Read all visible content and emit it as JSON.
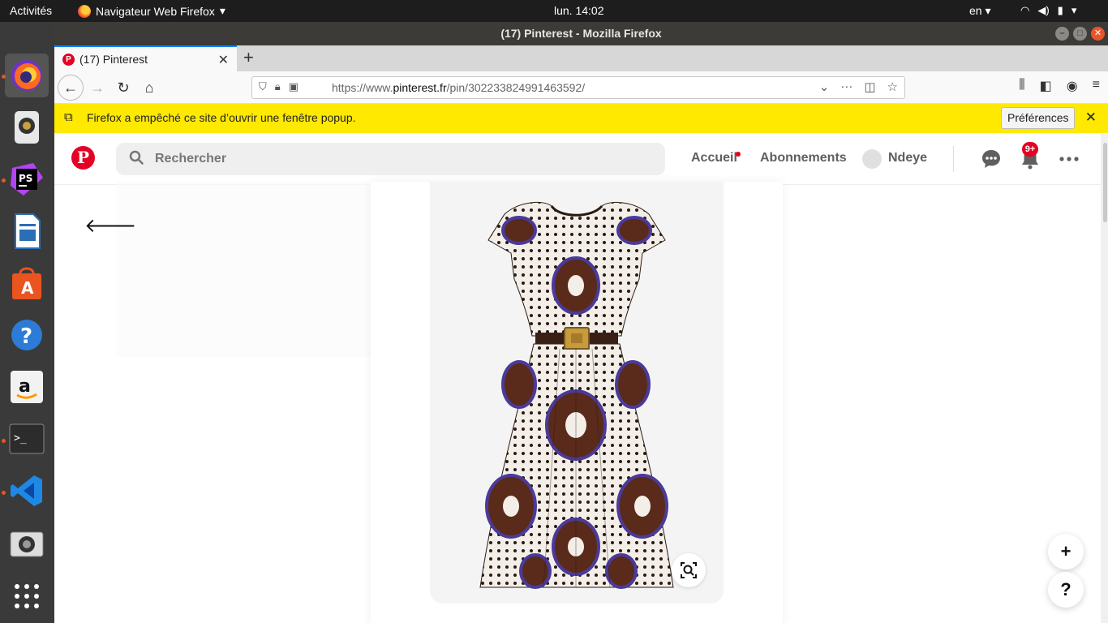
{
  "system": {
    "activities": "Activités",
    "app_menu": "Navigateur Web Firefox",
    "clock": "lun. 14:02",
    "lang": "en"
  },
  "dock": {
    "items": [
      "firefox-icon",
      "speaker-app-icon",
      "phpstorm-icon",
      "writer-icon",
      "app-center-icon",
      "help-icon",
      "amazon-icon",
      "terminal-icon",
      "vscode-icon",
      "camera-icon",
      "app-grid-icon"
    ]
  },
  "window": {
    "title": "(17) Pinterest - Mozilla Firefox"
  },
  "tab": {
    "title": "(17) Pinterest"
  },
  "urlbar": {
    "prefix": "https://www.",
    "domain": "pinterest.fr",
    "path": "/pin/302233824991463592/"
  },
  "popup": {
    "message": "Firefox a empêché ce site d’ouvrir une fenêtre popup.",
    "button": "Préférences"
  },
  "pinterest": {
    "logo": "P",
    "search_placeholder": "Rechercher",
    "nav": {
      "home": "Accueil",
      "following": "Abonnements",
      "user": "Ndeye"
    },
    "notifications_badge": "9+",
    "fab_add": "+",
    "fab_help": "?"
  },
  "colors": {
    "pinterest_red": "#e60023",
    "popup_yellow": "#ffe900",
    "dress_brown": "#5a2a1a",
    "dress_purple": "#4a3a9a"
  }
}
